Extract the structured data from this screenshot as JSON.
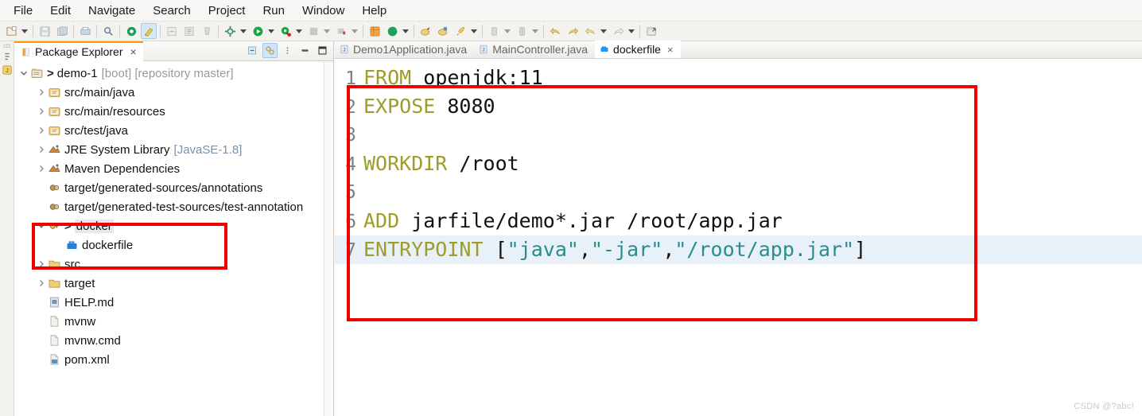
{
  "menubar": {
    "items": [
      {
        "label": "File"
      },
      {
        "label": "Edit"
      },
      {
        "label": "Navigate"
      },
      {
        "label": "Search"
      },
      {
        "label": "Project"
      },
      {
        "label": "Run"
      },
      {
        "label": "Window"
      },
      {
        "label": "Help"
      }
    ]
  },
  "toolbar": {
    "groups": [
      {
        "icons": [
          "new-wizard-icon",
          "dropdown-caret"
        ]
      },
      {
        "icons": [
          "save-icon",
          "save-all-icon"
        ]
      },
      {
        "icons": [
          "print-icon"
        ]
      },
      {
        "icons": [
          "search-icon"
        ]
      },
      {
        "icons": [
          "open-type-icon"
        ]
      },
      {
        "icons": [
          "highlight-icon"
        ]
      },
      {
        "icons": [
          "next-annotation-icon",
          "previous-annotation-icon",
          "last-edit-icon"
        ]
      },
      {
        "icons": [
          "external-tools-icon",
          "dropdown-caret"
        ]
      },
      {
        "icons": [
          "run-icon",
          "dropdown-caret"
        ]
      },
      {
        "icons": [
          "debug-icon",
          "dropdown-caret"
        ]
      },
      {
        "icons": [
          "coverage-icon",
          "dropdown-caret"
        ]
      },
      {
        "icons": [
          "profile-icon",
          "dropdown-caret"
        ]
      },
      {
        "icons": [
          "spring-boot-dashboard-icon",
          "git-icon",
          "dropdown-caret"
        ]
      },
      {
        "icons": [
          "commit-icon",
          "push-icon",
          "rocket-icon",
          "dropdown-caret"
        ]
      },
      {
        "icons": [
          "pull-icon",
          "dropdown-caret"
        ]
      },
      {
        "icons": [
          "fetch-icon",
          "dropdown-caret"
        ]
      },
      {
        "icons": [
          "back-icon",
          "forward-icon",
          "undo-nav-icon",
          "dropdown-caret"
        ]
      },
      {
        "icons": [
          "redo-nav-icon",
          "dropdown-caret"
        ]
      },
      {
        "icons": [
          "open-perspective-icon"
        ]
      }
    ]
  },
  "explorer": {
    "tab": {
      "label": "Package Explorer",
      "icon": "package-explorer-icon",
      "close": "×"
    },
    "tools": [
      {
        "name": "collapse-all-icon"
      },
      {
        "name": "link-with-editor-icon",
        "selected": true
      },
      {
        "name": "view-menu-icon"
      },
      {
        "name": "minimize-icon"
      },
      {
        "name": "maximize-icon"
      }
    ],
    "tree": [
      {
        "indent": 0,
        "arrow": "down",
        "icon": "project-icon",
        "gt": ">",
        "label": "demo-1",
        "meta": "[boot] [repository master]",
        "metaStyle": "grey"
      },
      {
        "indent": 1,
        "arrow": "right",
        "icon": "source-folder-icon",
        "label": "src/main/java",
        "meta": ""
      },
      {
        "indent": 1,
        "arrow": "right",
        "icon": "source-folder-icon",
        "label": "src/main/resources",
        "meta": ""
      },
      {
        "indent": 1,
        "arrow": "right",
        "icon": "source-folder-icon",
        "label": "src/test/java",
        "meta": ""
      },
      {
        "indent": 1,
        "arrow": "right",
        "icon": "library-icon",
        "label": "JRE System Library",
        "meta": "[JavaSE-1.8]",
        "metaStyle": "blue"
      },
      {
        "indent": 1,
        "arrow": "right",
        "icon": "library-icon",
        "label": "Maven Dependencies",
        "meta": ""
      },
      {
        "indent": 1,
        "arrow": "none",
        "icon": "generated-folder-icon",
        "label": "target/generated-sources/annotations",
        "meta": ""
      },
      {
        "indent": 1,
        "arrow": "none",
        "icon": "generated-folder-icon",
        "label": "target/generated-test-sources/test-annotation",
        "meta": ""
      },
      {
        "indent": 1,
        "arrow": "down",
        "icon": "docker-folder-icon",
        "gt": ">",
        "label": "docker",
        "meta": "",
        "highlighted": true
      },
      {
        "indent": 2,
        "arrow": "none",
        "icon": "dockerfile-icon",
        "label": "dockerfile",
        "meta": ""
      },
      {
        "indent": 1,
        "arrow": "right",
        "icon": "folder-icon",
        "label": "src",
        "meta": ""
      },
      {
        "indent": 1,
        "arrow": "right",
        "icon": "folder-icon",
        "label": "target",
        "meta": ""
      },
      {
        "indent": 1,
        "arrow": "none",
        "icon": "markdown-file-icon",
        "label": "HELP.md",
        "meta": ""
      },
      {
        "indent": 1,
        "arrow": "none",
        "icon": "file-icon",
        "label": "mvnw",
        "meta": ""
      },
      {
        "indent": 1,
        "arrow": "none",
        "icon": "file-icon",
        "label": "mvnw.cmd",
        "meta": ""
      },
      {
        "indent": 1,
        "arrow": "none",
        "icon": "xml-file-icon",
        "label": "pom.xml",
        "meta": ""
      }
    ]
  },
  "editor": {
    "tabs": [
      {
        "label": "Demo1Application.java",
        "icon": "java-file-icon",
        "active": false,
        "closable": false
      },
      {
        "label": "MainController.java",
        "icon": "java-file-icon",
        "active": false,
        "closable": false
      },
      {
        "label": "dockerfile",
        "icon": "dockerfile-icon",
        "active": true,
        "closable": true,
        "close": "×"
      }
    ],
    "lines": [
      {
        "no": "1",
        "tokens": [
          {
            "t": "FROM",
            "c": "kw"
          },
          {
            "t": " openjdk:11",
            "c": "plain"
          }
        ],
        "current": false
      },
      {
        "no": "2",
        "tokens": [
          {
            "t": "EXPOSE",
            "c": "kw"
          },
          {
            "t": " 8080",
            "c": "plain"
          }
        ],
        "current": false
      },
      {
        "no": "3",
        "tokens": [],
        "current": false
      },
      {
        "no": "4",
        "tokens": [
          {
            "t": "WORKDIR",
            "c": "kw"
          },
          {
            "t": " /root",
            "c": "plain"
          }
        ],
        "current": false
      },
      {
        "no": "5",
        "tokens": [],
        "current": false
      },
      {
        "no": "6",
        "tokens": [
          {
            "t": "ADD",
            "c": "kw"
          },
          {
            "t": " jarfile/demo*.jar /root/app.jar",
            "c": "plain"
          }
        ],
        "current": false
      },
      {
        "no": "7",
        "tokens": [
          {
            "t": "ENTRYPOINT",
            "c": "kw"
          },
          {
            "t": " [",
            "c": "punc"
          },
          {
            "t": "\"java\"",
            "c": "str"
          },
          {
            "t": ",",
            "c": "punc"
          },
          {
            "t": "\"-jar\"",
            "c": "str"
          },
          {
            "t": ",",
            "c": "punc"
          },
          {
            "t": "\"/root/app.jar\"",
            "c": "str"
          },
          {
            "t": "]",
            "c": "punc"
          }
        ],
        "current": true
      }
    ]
  },
  "annotations": {
    "highlight_color": "#ee0000",
    "boxes": [
      {
        "name": "docker-folder-highlight"
      },
      {
        "name": "dockerfile-code-highlight"
      }
    ]
  },
  "watermark": {
    "text": "CSDN @?abc!"
  }
}
